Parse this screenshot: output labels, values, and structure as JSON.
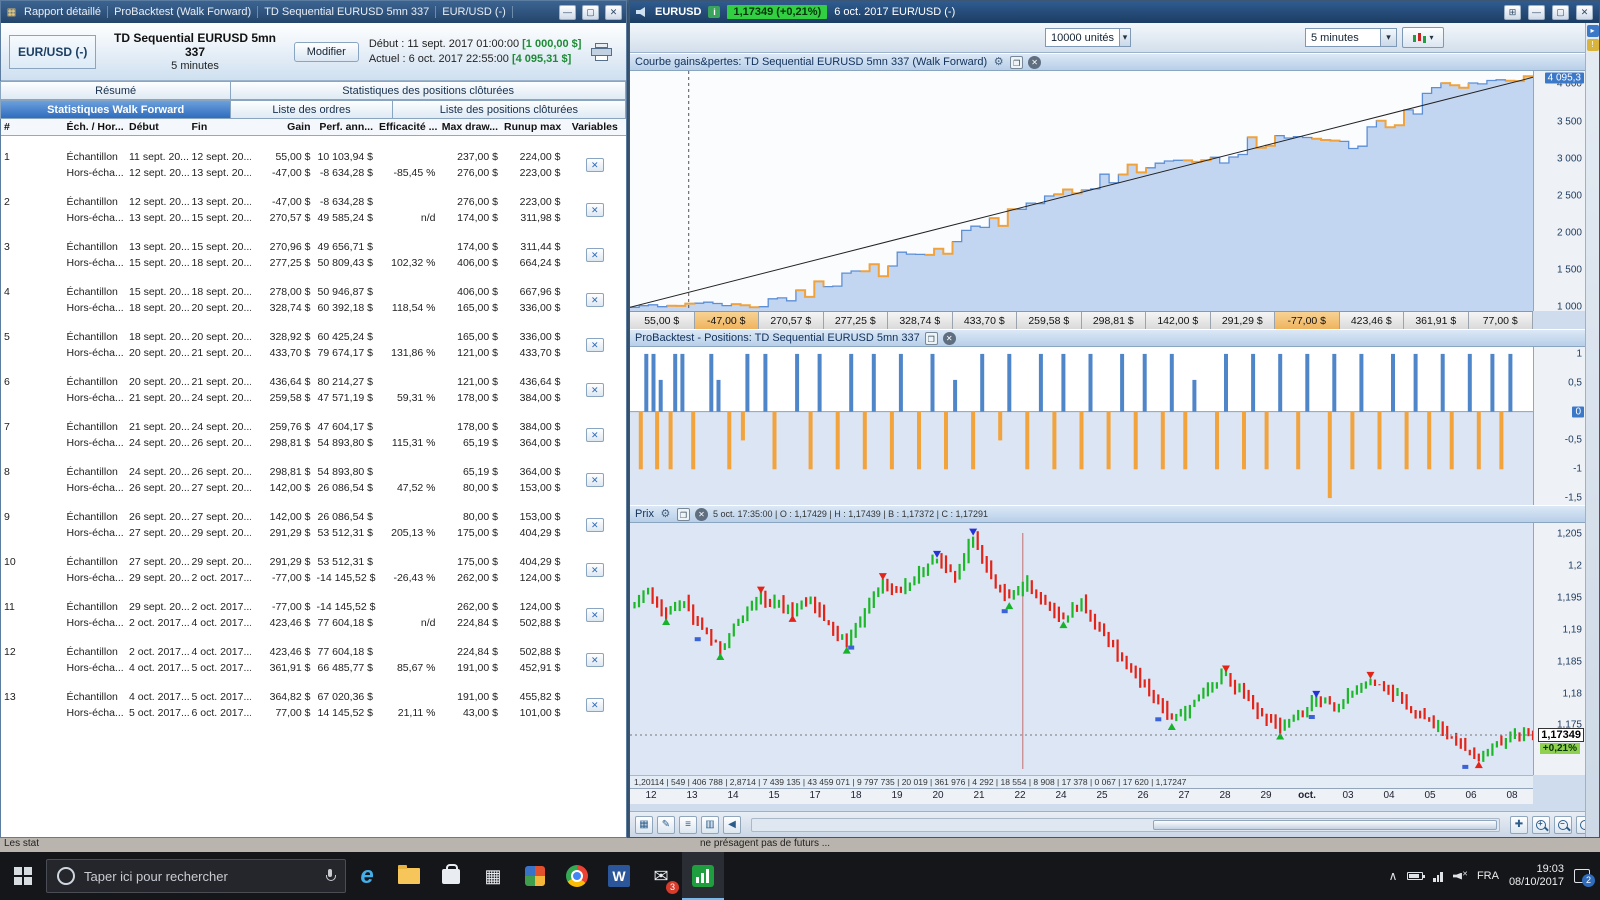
{
  "icons": {
    "app": "▦",
    "minimize": "—",
    "maximize": "▢",
    "close": "✕",
    "dropdown": "▾",
    "grid": "⊞",
    "info": "i",
    "gear": "⚙",
    "panel_window": "❐",
    "panel_close": "✕",
    "back": "◀",
    "chevron_up": "∧",
    "mail": "✉",
    "edge": "e",
    "word": "W",
    "calc": "▦",
    "plus": "+",
    "minus": "−",
    "var_close": "✕"
  },
  "report_window": {
    "titlebar_items": [
      "Rapport détaillé",
      "ProBacktest (Walk Forward)",
      "TD Sequential EURUSD 5mn 337",
      "EUR/USD (-)"
    ],
    "instrument": "EUR/USD (-)",
    "strategy_name": "TD Sequential EURUSD 5mn 337",
    "timeframe": "5 minutes",
    "modify_button": "Modifier",
    "start_label": "Début :",
    "start_value": "11 sept. 2017 01:00:00",
    "start_amount": "[1 000,00 $]",
    "current_label": "Actuel :",
    "current_value": "6 oct. 2017 22:55:00",
    "current_amount": "[4 095,31 $]",
    "tabs_row1": [
      "Résumé",
      "Statistiques des positions clôturées"
    ],
    "tabs_row2": [
      "Statistiques Walk Forward",
      "Liste des ordres",
      "Liste des positions clôturées"
    ],
    "table": {
      "columns": [
        "#",
        "Éch. / Hor...",
        "Début",
        "Fin",
        "Gain",
        "Perf. ann...",
        "Efficacité ...",
        "Max draw...",
        "Runup max",
        "Variables"
      ],
      "groups": [
        {
          "n": "1",
          "rows": [
            {
              "t": "Échantillon",
              "d": "11 sept. 20...",
              "f": "12 sept. 20...",
              "g": "55,00 $",
              "p": "10 103,94 $",
              "e": "",
              "m": "237,00 $",
              "r": "224,00 $"
            },
            {
              "t": "Hors-écha...",
              "d": "12 sept. 20...",
              "f": "13 sept. 20...",
              "g": "-47,00 $",
              "p": "-8 634,28 $",
              "e": "-85,45 %",
              "m": "276,00 $",
              "r": "223,00 $"
            }
          ]
        },
        {
          "n": "2",
          "rows": [
            {
              "t": "Échantillon",
              "d": "12 sept. 20...",
              "f": "13 sept. 20...",
              "g": "-47,00 $",
              "p": "-8 634,28 $",
              "e": "",
              "m": "276,00 $",
              "r": "223,00 $"
            },
            {
              "t": "Hors-écha...",
              "d": "13 sept. 20...",
              "f": "15 sept. 20...",
              "g": "270,57 $",
              "p": "49 585,24 $",
              "e": "n/d",
              "m": "174,00 $",
              "r": "311,98 $"
            }
          ]
        },
        {
          "n": "3",
          "rows": [
            {
              "t": "Échantillon",
              "d": "13 sept. 20...",
              "f": "15 sept. 20...",
              "g": "270,96 $",
              "p": "49 656,71 $",
              "e": "",
              "m": "174,00 $",
              "r": "311,44 $"
            },
            {
              "t": "Hors-écha...",
              "d": "15 sept. 20...",
              "f": "18 sept. 20...",
              "g": "277,25 $",
              "p": "50 809,43 $",
              "e": "102,32 %",
              "m": "406,00 $",
              "r": "664,24 $"
            }
          ]
        },
        {
          "n": "4",
          "rows": [
            {
              "t": "Échantillon",
              "d": "15 sept. 20...",
              "f": "18 sept. 20...",
              "g": "278,00 $",
              "p": "50 946,87 $",
              "e": "",
              "m": "406,00 $",
              "r": "667,96 $"
            },
            {
              "t": "Hors-écha...",
              "d": "18 sept. 20...",
              "f": "20 sept. 20...",
              "g": "328,74 $",
              "p": "60 392,18 $",
              "e": "118,54 %",
              "m": "165,00 $",
              "r": "336,00 $"
            }
          ]
        },
        {
          "n": "5",
          "rows": [
            {
              "t": "Échantillon",
              "d": "18 sept. 20...",
              "f": "20 sept. 20...",
              "g": "328,92 $",
              "p": "60 425,24 $",
              "e": "",
              "m": "165,00 $",
              "r": "336,00 $"
            },
            {
              "t": "Hors-écha...",
              "d": "20 sept. 20...",
              "f": "21 sept. 20...",
              "g": "433,70 $",
              "p": "79 674,17 $",
              "e": "131,86 %",
              "m": "121,00 $",
              "r": "433,70 $"
            }
          ]
        },
        {
          "n": "6",
          "rows": [
            {
              "t": "Échantillon",
              "d": "20 sept. 20...",
              "f": "21 sept. 20...",
              "g": "436,64 $",
              "p": "80 214,27 $",
              "e": "",
              "m": "121,00 $",
              "r": "436,64 $"
            },
            {
              "t": "Hors-écha...",
              "d": "21 sept. 20...",
              "f": "24 sept. 20...",
              "g": "259,58 $",
              "p": "47 571,19 $",
              "e": "59,31 %",
              "m": "178,00 $",
              "r": "384,00 $"
            }
          ]
        },
        {
          "n": "7",
          "rows": [
            {
              "t": "Échantillon",
              "d": "21 sept. 20...",
              "f": "24 sept. 20...",
              "g": "259,76 $",
              "p": "47 604,17 $",
              "e": "",
              "m": "178,00 $",
              "r": "384,00 $"
            },
            {
              "t": "Hors-écha...",
              "d": "24 sept. 20...",
              "f": "26 sept. 20...",
              "g": "298,81 $",
              "p": "54 893,80 $",
              "e": "115,31 %",
              "m": "65,19 $",
              "r": "364,00 $"
            }
          ]
        },
        {
          "n": "8",
          "rows": [
            {
              "t": "Échantillon",
              "d": "24 sept. 20...",
              "f": "26 sept. 20...",
              "g": "298,81 $",
              "p": "54 893,80 $",
              "e": "",
              "m": "65,19 $",
              "r": "364,00 $"
            },
            {
              "t": "Hors-écha...",
              "d": "26 sept. 20...",
              "f": "27 sept. 20...",
              "g": "142,00 $",
              "p": "26 086,54 $",
              "e": "47,52 %",
              "m": "80,00 $",
              "r": "153,00 $"
            }
          ]
        },
        {
          "n": "9",
          "rows": [
            {
              "t": "Échantillon",
              "d": "26 sept. 20...",
              "f": "27 sept. 20...",
              "g": "142,00 $",
              "p": "26 086,54 $",
              "e": "",
              "m": "80,00 $",
              "r": "153,00 $"
            },
            {
              "t": "Hors-écha...",
              "d": "27 sept. 20...",
              "f": "29 sept. 20...",
              "g": "291,29 $",
              "p": "53 512,31 $",
              "e": "205,13 %",
              "m": "175,00 $",
              "r": "404,29 $"
            }
          ]
        },
        {
          "n": "10",
          "rows": [
            {
              "t": "Échantillon",
              "d": "27 sept. 20...",
              "f": "29 sept. 20...",
              "g": "291,29 $",
              "p": "53 512,31 $",
              "e": "",
              "m": "175,00 $",
              "r": "404,29 $"
            },
            {
              "t": "Hors-écha...",
              "d": "29 sept. 20...",
              "f": "2 oct. 2017...",
              "g": "-77,00 $",
              "p": "-14 145,52 $",
              "e": "-26,43 %",
              "m": "262,00 $",
              "r": "124,00 $"
            }
          ]
        },
        {
          "n": "11",
          "rows": [
            {
              "t": "Échantillon",
              "d": "29 sept. 20...",
              "f": "2 oct. 2017...",
              "g": "-77,00 $",
              "p": "-14 145,52 $",
              "e": "",
              "m": "262,00 $",
              "r": "124,00 $"
            },
            {
              "t": "Hors-écha...",
              "d": "2 oct. 2017...",
              "f": "4 oct. 2017...",
              "g": "423,46 $",
              "p": "77 604,18 $",
              "e": "n/d",
              "m": "224,84 $",
              "r": "502,88 $"
            }
          ]
        },
        {
          "n": "12",
          "rows": [
            {
              "t": "Échantillon",
              "d": "2 oct. 2017...",
              "f": "4 oct. 2017...",
              "g": "423,46 $",
              "p": "77 604,18 $",
              "e": "",
              "m": "224,84 $",
              "r": "502,88 $"
            },
            {
              "t": "Hors-écha...",
              "d": "4 oct. 2017...",
              "f": "5 oct. 2017...",
              "g": "361,91 $",
              "p": "66 485,77 $",
              "e": "85,67 %",
              "m": "191,00 $",
              "r": "452,91 $"
            }
          ]
        },
        {
          "n": "13",
          "rows": [
            {
              "t": "Échantillon",
              "d": "4 oct. 2017...",
              "f": "5 oct. 2017...",
              "g": "364,82 $",
              "p": "67 020,36 $",
              "e": "",
              "m": "191,00 $",
              "r": "455,82 $"
            },
            {
              "t": "Hors-écha...",
              "d": "5 oct. 2017...",
              "f": "6 oct. 2017...",
              "g": "77,00 $",
              "p": "14 145,52 $",
              "e": "21,11 %",
              "m": "43,00 $",
              "r": "101,00 $"
            }
          ]
        }
      ]
    }
  },
  "chart_window": {
    "titlebar": {
      "symbol": "EURUSD",
      "quote": "1,17349 (+0,21%)",
      "datetime": "6 oct. 2017  EUR/USD (-)"
    },
    "toolbar": {
      "units": "10000 unités",
      "timeframe": "5 minutes"
    }
  },
  "chart_data": [
    {
      "type": "area",
      "title": "Courbe gains&pertes: TD Sequential EURUSD 5mn 337 (Walk Forward)",
      "start_equity": 1000,
      "final_equity": 4095.31,
      "segment_gains": [
        55.0,
        -47.0,
        270.57,
        277.25,
        328.74,
        433.7,
        259.58,
        298.81,
        142.0,
        291.29,
        -77.0,
        423.46,
        361.91,
        77.0
      ],
      "segment_labels": [
        "55,00 $",
        "-47,00 $",
        "270,57 $",
        "277,25 $",
        "328,74 $",
        "433,70 $",
        "259,58 $",
        "298,81 $",
        "142,00 $",
        "291,29 $",
        "-77,00 $",
        "423,46 $",
        "361,91 $",
        "77,00 $"
      ],
      "y_ticks": [
        4000,
        3500,
        3000,
        2500,
        2000,
        1500,
        1000
      ],
      "y_tick_labels": [
        "4 000",
        "3 500",
        "3 000",
        "2 500",
        "2 000",
        "1 500",
        "1 000"
      ],
      "current_label": "4 095,3",
      "current_value": 4095.3,
      "ylim": [
        950,
        4180
      ],
      "legend_position": "none",
      "grid": false
    },
    {
      "type": "bar",
      "title": "ProBacktest - Positions: TD Sequential EURUSD 5mn 337",
      "y_ticks": [
        1,
        0.5,
        0,
        -0.5,
        -1,
        -1.5
      ],
      "y_tick_labels": [
        "1",
        "0,5",
        "0",
        "-0,5",
        "-1",
        "-1,5"
      ],
      "zero_label": "0",
      "ylim": [
        -1.62,
        1.12
      ],
      "long_bars": [
        [
          0.018,
          1
        ],
        [
          0.026,
          1
        ],
        [
          0.034,
          0.55
        ],
        [
          0.05,
          1
        ],
        [
          0.058,
          1
        ],
        [
          0.09,
          1
        ],
        [
          0.098,
          0.55
        ],
        [
          0.13,
          1
        ],
        [
          0.15,
          1
        ],
        [
          0.185,
          1
        ],
        [
          0.21,
          1
        ],
        [
          0.245,
          1
        ],
        [
          0.27,
          1
        ],
        [
          0.3,
          1
        ],
        [
          0.335,
          1
        ],
        [
          0.36,
          0.55
        ],
        [
          0.39,
          1
        ],
        [
          0.42,
          1
        ],
        [
          0.455,
          1
        ],
        [
          0.48,
          1
        ],
        [
          0.51,
          1
        ],
        [
          0.545,
          1
        ],
        [
          0.57,
          1
        ],
        [
          0.6,
          1
        ],
        [
          0.625,
          0.55
        ],
        [
          0.66,
          1
        ],
        [
          0.69,
          1
        ],
        [
          0.72,
          1
        ],
        [
          0.75,
          1
        ],
        [
          0.78,
          1
        ],
        [
          0.81,
          1
        ],
        [
          0.845,
          1
        ],
        [
          0.87,
          1
        ],
        [
          0.9,
          1
        ],
        [
          0.93,
          1
        ],
        [
          0.955,
          1
        ],
        [
          0.975,
          1
        ]
      ],
      "short_bars": [
        [
          0.012,
          1
        ],
        [
          0.03,
          1
        ],
        [
          0.045,
          1
        ],
        [
          0.07,
          1
        ],
        [
          0.11,
          1
        ],
        [
          0.125,
          0.5
        ],
        [
          0.16,
          1
        ],
        [
          0.2,
          1
        ],
        [
          0.23,
          1
        ],
        [
          0.26,
          1
        ],
        [
          0.29,
          1
        ],
        [
          0.32,
          1
        ],
        [
          0.35,
          1
        ],
        [
          0.38,
          1
        ],
        [
          0.41,
          0.5
        ],
        [
          0.44,
          1
        ],
        [
          0.47,
          1
        ],
        [
          0.5,
          1
        ],
        [
          0.53,
          1
        ],
        [
          0.56,
          1
        ],
        [
          0.59,
          1
        ],
        [
          0.615,
          1
        ],
        [
          0.65,
          1
        ],
        [
          0.68,
          1
        ],
        [
          0.705,
          1
        ],
        [
          0.74,
          1
        ],
        [
          0.775,
          1.5
        ],
        [
          0.8,
          1
        ],
        [
          0.83,
          1
        ],
        [
          0.86,
          1
        ],
        [
          0.885,
          1
        ],
        [
          0.91,
          1
        ],
        [
          0.94,
          1
        ],
        [
          0.965,
          1
        ]
      ]
    },
    {
      "type": "line",
      "title": "Prix",
      "ohlc_info": "5 oct. 17:35:00 | O : 1,17429 | H : 1,17439 | B : 1,17372 | C : 1,17291",
      "footer_info": "1,20114 | 549 | 406 788 | 2,8714 | 7 439 135 | 43 459 071 | 9 797 735 | 20 019 | 361 976 | 4 292 | 18 554 | 8 908 | 17 378 | 0 067 | 17 620 | 1,17247",
      "y_ticks": [
        1.205,
        1.2,
        1.195,
        1.19,
        1.185,
        1.18,
        1.175
      ],
      "y_tick_labels": [
        "1,205",
        "1,2",
        "1,195",
        "1,19",
        "1,185",
        "1,18",
        "1,175"
      ],
      "price_badge": "1,17349",
      "change_badge": "+0,21%",
      "x_ticks": [
        "12",
        "13",
        "14",
        "15",
        "17",
        "18",
        "19",
        "20",
        "21",
        "22",
        "24",
        "25",
        "26",
        "27",
        "28",
        "29",
        "oct.",
        "03",
        "04",
        "05",
        "06",
        "08"
      ],
      "closes": [
        1.1935,
        1.196,
        1.1925,
        1.1945,
        1.19,
        1.187,
        1.1915,
        1.195,
        1.1945,
        1.193,
        1.195,
        1.191,
        1.188,
        1.193,
        1.1975,
        1.196,
        1.199,
        1.201,
        1.1985,
        1.2045,
        1.198,
        1.195,
        1.1975,
        1.194,
        1.192,
        1.1945,
        1.19,
        1.186,
        1.183,
        1.179,
        1.176,
        1.178,
        1.181,
        1.183,
        1.1795,
        1.1765,
        1.1745,
        1.177,
        1.179,
        1.1775,
        1.18,
        1.182,
        1.1805,
        1.178,
        1.176,
        1.174,
        1.172,
        1.17,
        1.1725,
        1.1735,
        1.17349
      ],
      "ylim": [
        1.1672,
        1.2068
      ],
      "grid": false
    }
  ],
  "desktop": {
    "disclaimer_left": "Les stat",
    "disclaimer_center": "ne présagent pas de futurs ..."
  },
  "taskbar": {
    "search_placeholder": "Taper ici pour rechercher",
    "mail_badge": "3",
    "notif_badge": "2",
    "tray_lang": "FRA",
    "tray_time": "19:03",
    "tray_date": "08/10/2017"
  }
}
